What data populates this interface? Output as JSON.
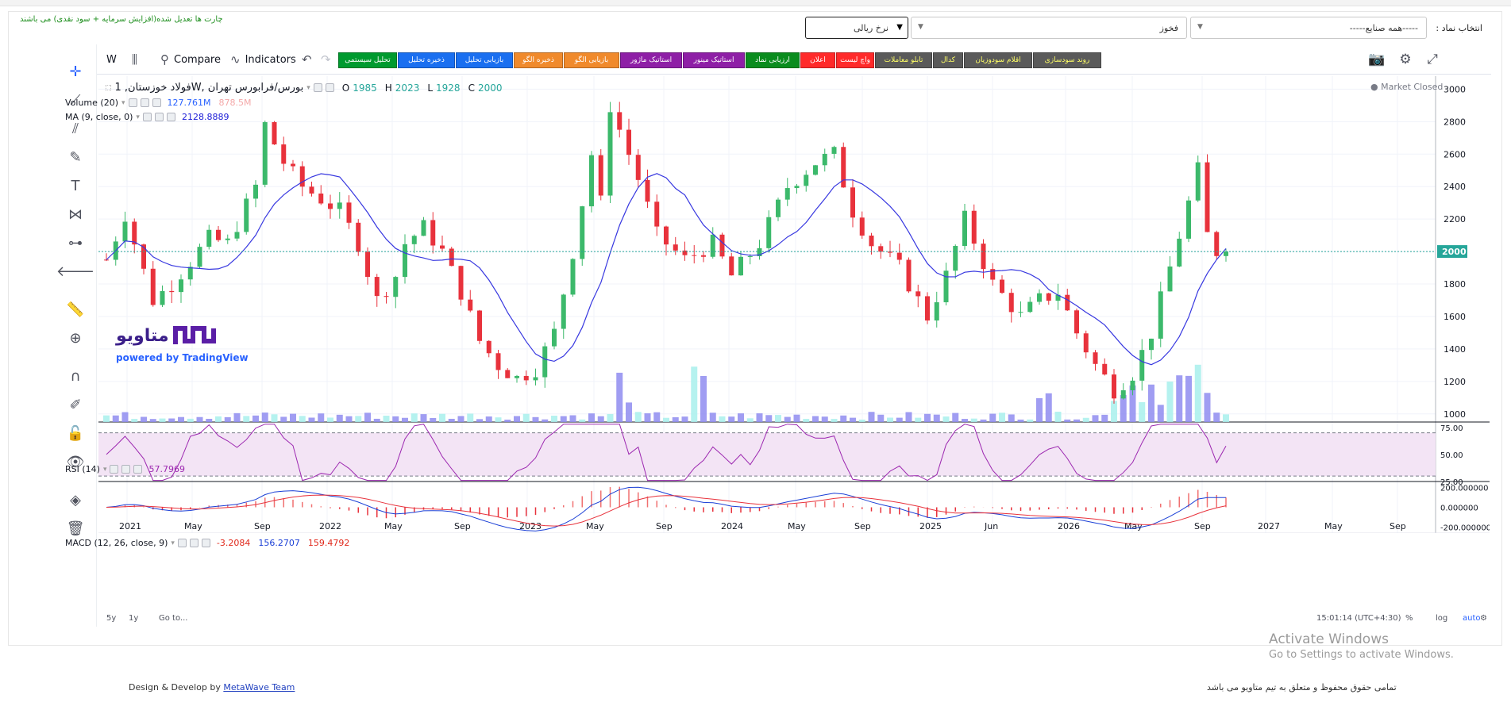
{
  "header": {
    "note": "چارت ها تعدیل شده(افزایش سرمایه + سود نقدی) می باشند",
    "symbol_label": "انتخاب نماد :",
    "industry_value": "-----همه صنایع-----",
    "symbol_value": "فخوز",
    "currency_value": "نرخ ریالی"
  },
  "toolbar": {
    "interval": "W",
    "compare": "Compare",
    "indicators": "Indicators",
    "buttons": [
      {
        "label": "تحلیل سیستمی",
        "bg": "#009a2f",
        "fg": "#ffffff"
      },
      {
        "label": "ذخیره تحلیل",
        "bg": "#1a6ff0",
        "fg": "#ffffff"
      },
      {
        "label": "بازیابی تحلیل",
        "bg": "#1a6ff0",
        "fg": "#ffffff"
      },
      {
        "label": "ذخیره الگو",
        "bg": "#f08a2c",
        "fg": "#ffffff"
      },
      {
        "label": "بازیابی الگو",
        "bg": "#f08a2c",
        "fg": "#ffffff"
      },
      {
        "label": "استاتیک ماژور",
        "bg": "#8e1fa6",
        "fg": "#ffffff"
      },
      {
        "label": "استاتیک مینور",
        "bg": "#8e1fa6",
        "fg": "#ffffff"
      },
      {
        "label": "ارزیابی نماد",
        "bg": "#0a8c1e",
        "fg": "#ffffff"
      },
      {
        "label": "اعلان",
        "bg": "#ff2a2a",
        "fg": "#ffffff"
      },
      {
        "label": "واچ لیست",
        "bg": "#ff2a2a",
        "fg": "#ffffff"
      },
      {
        "label": "تابلو معاملات",
        "bg": "#5a5a5a",
        "fg": "#ffff66"
      },
      {
        "label": "کدال",
        "bg": "#5a5a5a",
        "fg": "#ffff66"
      },
      {
        "label": "اقلام سودوزیان",
        "bg": "#5a5a5a",
        "fg": "#ffff66"
      },
      {
        "label": "روند سودسازی",
        "bg": "#5a5a5a",
        "fg": "#ffff66"
      }
    ]
  },
  "legend": {
    "title": "بورس/فرابورس تهران ,Wفولاد خوزستان, 1",
    "o_label": "O",
    "o": "1985",
    "h_label": "H",
    "h": "2023",
    "l_label": "L",
    "l": "1928",
    "c_label": "C",
    "c": "2000",
    "volume_label": "Volume (20)",
    "volume_value": "127.761M",
    "volume_ma": "878.5M",
    "ma_label": "MA (9, close, 0)",
    "ma_value": "2128.8889",
    "market_status": "Market Closed",
    "rsi_label": "RSI (14)",
    "rsi_value": "57.7969",
    "macd_label": "MACD (12, 26, close, 9)",
    "macd_hist": "-3.2084",
    "macd_line": "156.2707",
    "macd_signal": "159.4792"
  },
  "logo": {
    "brand": "متاویو",
    "powered": "powered by TradingView"
  },
  "bottom": {
    "range_5y": "5y",
    "range_1y": "1y",
    "goto": "Go to...",
    "time": "15:01:14 (UTC+4:30)",
    "percent": "%",
    "log": "log",
    "auto": "auto"
  },
  "footer": {
    "credit_prefix": "Design & Develop by",
    "credit_link": "MetaWave Team",
    "copyright": "تمامی حقوق محفوظ و متعلق به تیم متاویو می باشد"
  },
  "watermark": {
    "line1": "Activate Windows",
    "line2": "Go to Settings to activate Windows."
  },
  "chart_data": {
    "type": "candlestick",
    "title": "بورس/فرابورس تهران ,Wفولاد خوزستان, 1",
    "x_ticks": [
      "2021",
      "May",
      "Sep",
      "2022",
      "May",
      "Sep",
      "2023",
      "May",
      "Sep",
      "2024",
      "May",
      "Sep",
      "2025",
      "Jun",
      "2026",
      "May",
      "Sep",
      "2027",
      "May",
      "Sep"
    ],
    "y_ticks": [
      1000,
      1200,
      1400,
      1600,
      1800,
      2000,
      2200,
      2400,
      2600,
      2800,
      3000
    ],
    "ylim": [
      950,
      3080
    ],
    "last_price": 2000,
    "price_path": [
      [
        0,
        1950
      ],
      [
        2,
        2230
      ],
      [
        5,
        1700
      ],
      [
        7,
        1800
      ],
      [
        11,
        2080
      ],
      [
        13,
        2050
      ],
      [
        16,
        2400
      ],
      [
        17,
        2780
      ],
      [
        19,
        2550
      ],
      [
        21,
        2400
      ],
      [
        25,
        2250
      ],
      [
        27,
        2050
      ],
      [
        29,
        1700
      ],
      [
        31,
        1850
      ],
      [
        32,
        2050
      ],
      [
        34,
        2150
      ],
      [
        36,
        2000
      ],
      [
        38,
        1750
      ],
      [
        40,
        1450
      ],
      [
        42,
        1300
      ],
      [
        44,
        1220
      ],
      [
        46,
        1280
      ],
      [
        48,
        1500
      ],
      [
        50,
        2000
      ],
      [
        52,
        2600
      ],
      [
        53,
        2300
      ],
      [
        54,
        2900
      ],
      [
        57,
        2450
      ],
      [
        59,
        2100
      ],
      [
        62,
        1950
      ],
      [
        65,
        2050
      ],
      [
        67,
        1850
      ],
      [
        70,
        2050
      ],
      [
        73,
        2400
      ],
      [
        76,
        2550
      ],
      [
        78,
        2600
      ],
      [
        80,
        2250
      ],
      [
        82,
        2050
      ],
      [
        85,
        1900
      ],
      [
        88,
        1600
      ],
      [
        90,
        1850
      ],
      [
        92,
        2200
      ],
      [
        95,
        1800
      ],
      [
        98,
        1600
      ],
      [
        100,
        1700
      ],
      [
        102,
        1750
      ],
      [
        104,
        1500
      ],
      [
        106,
        1300
      ],
      [
        108,
        1150
      ],
      [
        110,
        1250
      ],
      [
        112,
        1500
      ],
      [
        114,
        1900
      ],
      [
        116,
        2300
      ],
      [
        117,
        2500
      ],
      [
        118,
        2100
      ],
      [
        119,
        2000
      ],
      [
        120,
        2000
      ]
    ],
    "rsi": {
      "levels": [
        70,
        30
      ],
      "ylim": [
        25,
        80
      ],
      "y_ticks": [
        25,
        50,
        75
      ],
      "last": 57.7969
    },
    "macd": {
      "y_ticks": [
        -200,
        0,
        200
      ],
      "last_macd": 156.2707,
      "last_signal": 159.4792,
      "last_hist": -3.2084
    }
  }
}
